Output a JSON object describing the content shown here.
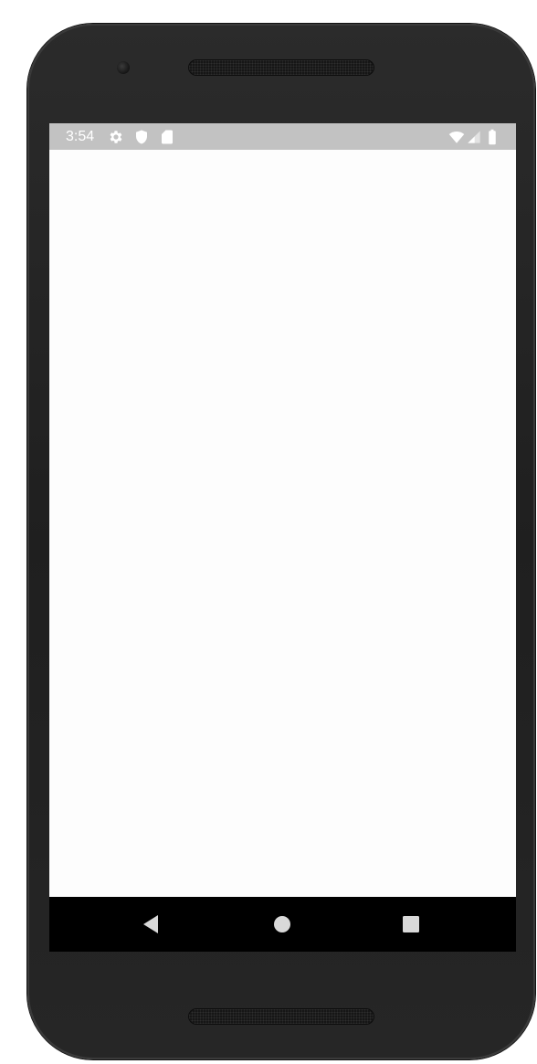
{
  "status_bar": {
    "time": "3:54",
    "left_icons": [
      "settings-gear-icon",
      "shield-icon",
      "sd-card-icon"
    ],
    "right_icons": [
      "wifi-icon",
      "cell-signal-icon",
      "battery-icon"
    ],
    "background_color": "#c2c2c2",
    "icon_color": "#ffffff"
  },
  "navigation_bar": {
    "buttons": [
      "back-icon",
      "home-icon",
      "recents-icon"
    ],
    "background_color": "#000000",
    "button_color": "#d9d9d9"
  },
  "app_content": {
    "background_color": "#fdfdfd"
  },
  "device": {
    "frame_color": "#242424"
  }
}
